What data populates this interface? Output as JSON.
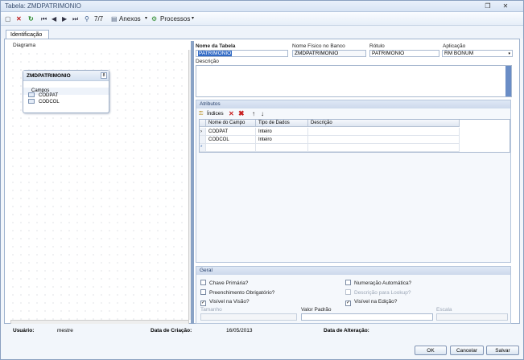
{
  "window": {
    "title": "Tabela: ZMDPATRIMONIO"
  },
  "toolbar": {
    "record_counter": "7/7",
    "attachments_label": "Anexos",
    "processes_label": "Processos"
  },
  "tabs": [
    {
      "label": "Identificação"
    }
  ],
  "diagram": {
    "label": "Diagrama",
    "table_name": "ZMDPATRIMONIO",
    "fields_header": "Campos",
    "fields": [
      "CODPAT",
      "CODCOL"
    ],
    "badge": "8"
  },
  "form": {
    "table_name_label": "Nome da Tabela",
    "table_name_value": "PATRIMONIO",
    "physical_name_label": "Nome Físico no Banco",
    "physical_name_value": "ZMDPATRIMONIO",
    "rotulo_label": "Rótulo",
    "rotulo_value": "PATRIMONIO",
    "aplicacao_label": "Aplicação",
    "aplicacao_value": "RM BONUM",
    "descricao_label": "Descrição"
  },
  "atributos": {
    "header": "Atributos",
    "indices_label": "Índices",
    "columns": [
      "Nome do Campo",
      "Tipo de Dados",
      "Descrição"
    ],
    "rows": [
      {
        "marker": "›",
        "name": "CODPAT",
        "type": "Inteiro",
        "desc": ""
      },
      {
        "marker": "",
        "name": "CODCOL",
        "type": "Inteiro",
        "desc": ""
      },
      {
        "marker": "*",
        "name": "",
        "type": "",
        "desc": ""
      }
    ]
  },
  "geral": {
    "header": "Geral",
    "chave_primaria": {
      "label": "Chave Primária?",
      "checked": false
    },
    "numeracao_automatica": {
      "label": "Numeração Automática?",
      "checked": false
    },
    "preenchimento_obrigatorio": {
      "label": "Preenchimento Obrigatório?",
      "checked": false
    },
    "descricao_lookup": {
      "label": "Descrição para Lookup?",
      "checked": false
    },
    "visivel_visao": {
      "label": "Visível na Visão?",
      "checked": true
    },
    "visivel_edicao": {
      "label": "Visível na Edição?",
      "checked": true
    },
    "tamanho_label": "Tamanho",
    "valor_padrao_label": "Valor Padrão",
    "escala_label": "Escala"
  },
  "footer": {
    "usuario_label": "Usuário:",
    "usuario_value": "mestre",
    "criacao_label": "Data de Criação:",
    "criacao_value": "16/05/2013",
    "alteracao_label": "Data de Alteração:",
    "alteracao_value": ""
  },
  "buttons": {
    "ok": "OK",
    "cancelar": "Cancelar",
    "salvar": "Salvar"
  },
  "colors": {
    "accent": "#316ac5",
    "panel_header": "#cdd9ec",
    "splitter": "#8aa3c6"
  }
}
